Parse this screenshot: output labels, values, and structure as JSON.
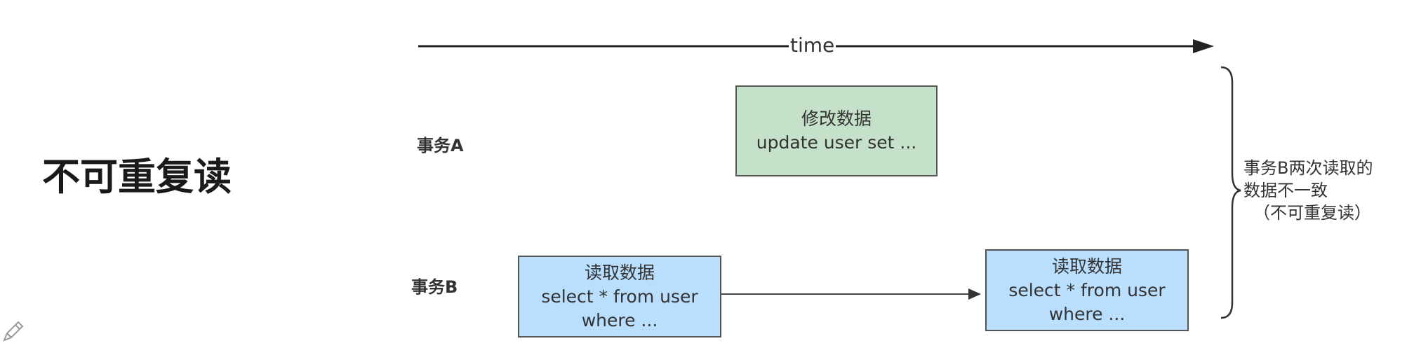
{
  "title": "不可重复读",
  "timeline": {
    "label": "time"
  },
  "rows": {
    "a": {
      "label": "事务A"
    },
    "b": {
      "label": "事务B"
    }
  },
  "boxes": {
    "a_update": {
      "line1": "修改数据",
      "line2": "update user set ..."
    },
    "b_read1": {
      "line1": "读取数据",
      "line2": "select * from user",
      "line3": "where ..."
    },
    "b_read2": {
      "line1": "读取数据",
      "line2": "select * from user",
      "line3": "where ..."
    }
  },
  "note": {
    "line1": "事务B两次读取的",
    "line2": "数据不一致",
    "line3": "（不可重复读）"
  },
  "colors": {
    "green_box": "#c5e1c9",
    "blue_box": "#b9defe",
    "line": "#222222"
  },
  "icons": {
    "corner": "pencil-icon"
  }
}
